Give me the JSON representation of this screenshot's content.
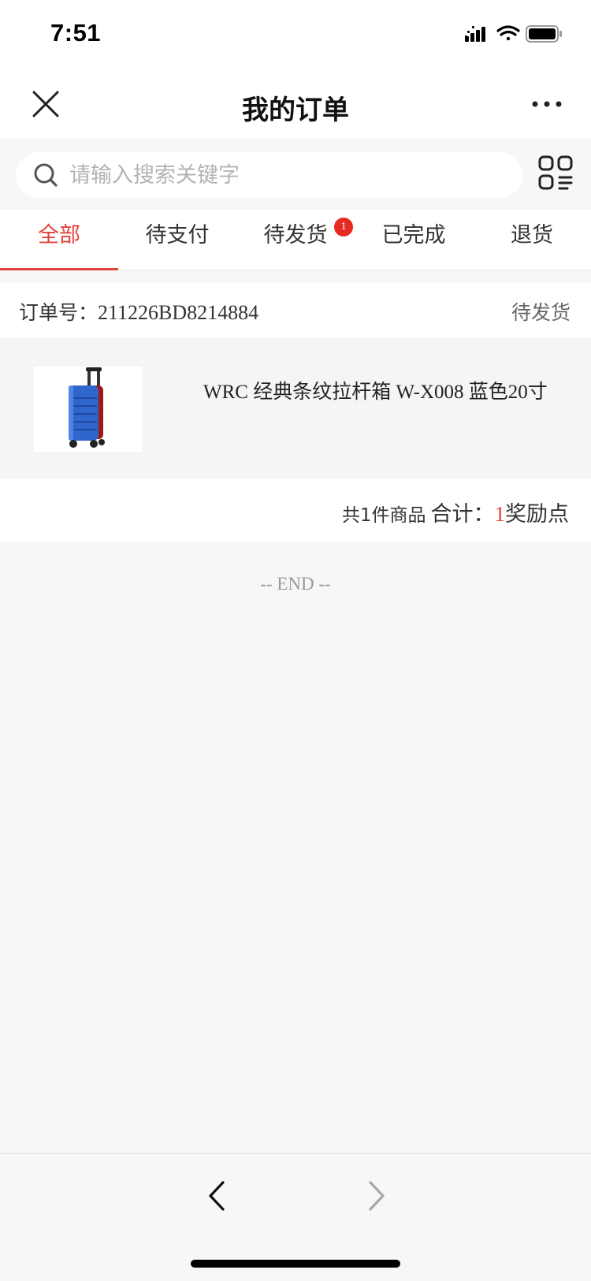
{
  "status_bar": {
    "time": "7:51"
  },
  "nav": {
    "title": "我的订单"
  },
  "search": {
    "placeholder": "请输入搜索关键字"
  },
  "tabs": [
    {
      "label": "全部",
      "active": true
    },
    {
      "label": "待支付"
    },
    {
      "label": "待发货",
      "badge": "1"
    },
    {
      "label": "已完成"
    },
    {
      "label": "退货"
    }
  ],
  "order": {
    "number_label": "订单号：",
    "number": "211226BD8214884",
    "status": "待发货",
    "product_name": "WRC 经典条纹拉杆箱 W-X008 蓝色20寸",
    "summary_count": "共1件商品",
    "summary_total_label": "合计：",
    "summary_points": "1",
    "summary_unit": "奖励点"
  },
  "end_text": "-- END --",
  "colors": {
    "accent": "#e5413b",
    "badge": "#e52b22"
  }
}
